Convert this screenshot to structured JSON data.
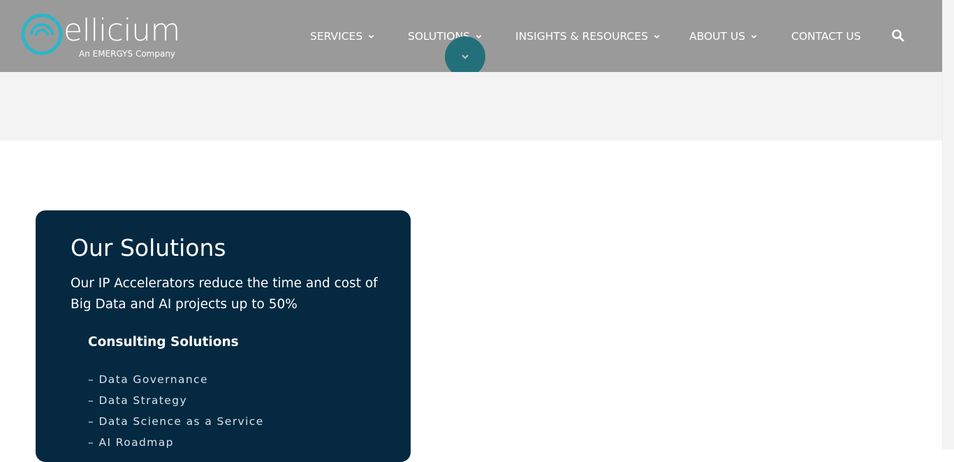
{
  "header": {
    "logo_word": "ellicium",
    "logo_tagline": "An EMERGYS Company",
    "nav": [
      {
        "label": "SERVICES",
        "has_dropdown": true
      },
      {
        "label": "SOLUTIONS",
        "has_dropdown": true
      },
      {
        "label": "INSIGHTS & RESOURCES",
        "has_dropdown": true
      },
      {
        "label": "ABOUT US",
        "has_dropdown": true
      },
      {
        "label": "CONTACT US",
        "has_dropdown": false
      }
    ],
    "search_icon": "search-icon",
    "scroll_button_icon": "chevron-down-icon"
  },
  "solutions_card": {
    "title": "Our Solutions",
    "description": "Our IP Accelerators reduce the time and cost of Big Data and AI projects up to 50%",
    "subheading": "Consulting Solutions",
    "items": [
      "– Data Governance",
      "– Data Strategy",
      "– Data Science as a Service",
      "– AI Roadmap"
    ]
  },
  "colors": {
    "header_bg": "#9a9a9a",
    "logo_accent": "#2ab7c9",
    "scroll_button": "#24707a",
    "band_bg": "#f3f3f3",
    "card_bg": "#042941"
  }
}
